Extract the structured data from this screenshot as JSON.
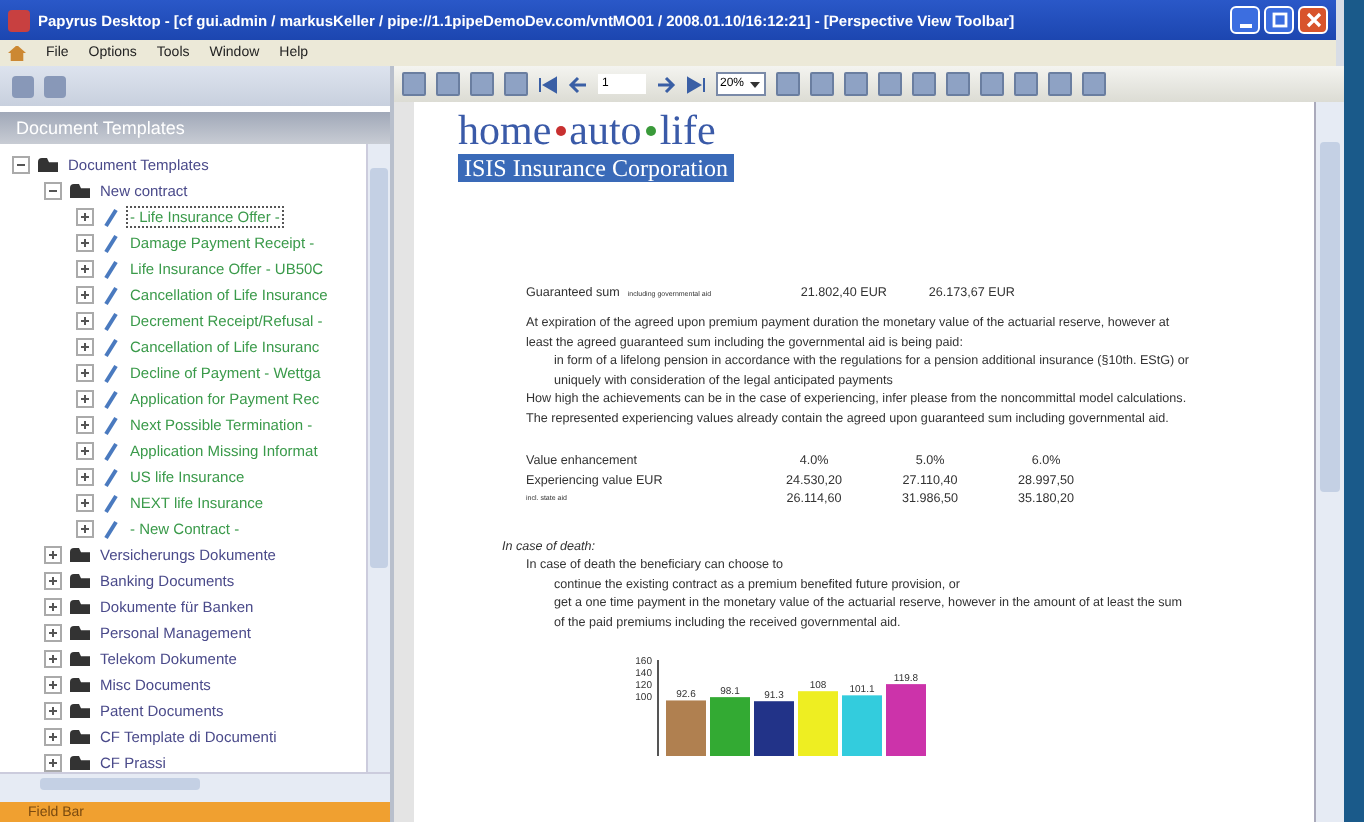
{
  "window": {
    "title": "Papyrus Desktop - [cf gui.admin / markusKeller / pipe://1.1pipeDemoDev.com/vntMO01 / 2008.01.10/16:12:21] - [Perspective View Toolbar]"
  },
  "menu": [
    "File",
    "Options",
    "Tools",
    "Window",
    "Help"
  ],
  "toolbar": {
    "page": "1",
    "zoom": "20%"
  },
  "sidebar": {
    "title": "Document Templates",
    "footer": "Field Bar",
    "tree": [
      {
        "label": "Document Templates",
        "kind": "folder",
        "expanded": true,
        "selected": false,
        "children": [
          {
            "label": "New contract",
            "kind": "folder",
            "expanded": true,
            "selected": false,
            "children": [
              {
                "label": "- Life Insurance Offer -",
                "kind": "template",
                "expanded": false,
                "selected": true
              },
              {
                "label": "Damage Payment Receipt -",
                "kind": "template",
                "expanded": false,
                "selected": false
              },
              {
                "label": "Life Insurance Offer - UB50C",
                "kind": "template",
                "expanded": false,
                "selected": false
              },
              {
                "label": "Cancellation of Life Insurance",
                "kind": "template",
                "expanded": false,
                "selected": false
              },
              {
                "label": "Decrement Receipt/Refusal - ",
                "kind": "template",
                "expanded": false,
                "selected": false
              },
              {
                "label": "Cancellation of Life Insuranc",
                "kind": "template",
                "expanded": false,
                "selected": false
              },
              {
                "label": "Decline of Payment - Wettga",
                "kind": "template",
                "expanded": false,
                "selected": false
              },
              {
                "label": "Application for Payment Rec",
                "kind": "template",
                "expanded": false,
                "selected": false
              },
              {
                "label": "Next Possible Termination - ",
                "kind": "template",
                "expanded": false,
                "selected": false
              },
              {
                "label": "Application Missing Informat",
                "kind": "template",
                "expanded": false,
                "selected": false
              },
              {
                "label": "US life Insurance",
                "kind": "template",
                "expanded": false,
                "selected": false
              },
              {
                "label": "NEXT life Insurance",
                "kind": "template",
                "expanded": false,
                "selected": false
              },
              {
                "label": "- New Contract -",
                "kind": "template",
                "expanded": false,
                "selected": false
              }
            ]
          },
          {
            "label": "Versicherungs Dokumente",
            "kind": "folder",
            "expanded": false,
            "selected": false
          },
          {
            "label": "Banking Documents",
            "kind": "folder",
            "expanded": false,
            "selected": false
          },
          {
            "label": "Dokumente für Banken",
            "kind": "folder",
            "expanded": false,
            "selected": false
          },
          {
            "label": "Personal Management",
            "kind": "folder",
            "expanded": false,
            "selected": false
          },
          {
            "label": "Telekom Dokumente",
            "kind": "folder",
            "expanded": false,
            "selected": false
          },
          {
            "label": "Misc Documents",
            "kind": "folder",
            "expanded": false,
            "selected": false
          },
          {
            "label": "Patent Documents",
            "kind": "folder",
            "expanded": false,
            "selected": false
          },
          {
            "label": "CF Template di Documenti",
            "kind": "folder",
            "expanded": false,
            "selected": false
          },
          {
            "label": "CF Prassi",
            "kind": "folder",
            "expanded": false,
            "selected": false
          }
        ]
      }
    ]
  },
  "document": {
    "logo_top": [
      "home",
      "auto",
      "life"
    ],
    "logo_bottom": "ISIS Insurance Corporation",
    "guaranteed": {
      "label": "Guaranteed sum",
      "note": "including governmental aid",
      "values": [
        "21.802,40 EUR",
        "26.173,67 EUR"
      ]
    },
    "paragraph": "At expiration of the agreed upon premium payment duration the monetary value of the actuarial reserve, however at least the agreed guaranteed sum including the governmental aid is being paid:",
    "bullets": [
      "in form of a lifelong pension in accordance with the regulations for a pension additional insurance (§10th. EStG) or",
      "uniquely with consideration of the legal anticipated payments"
    ],
    "paragraph2": "How high the achievements can be in the case of experiencing, infer please from the noncommittal model calculations. The represented experiencing values already contain the agreed upon guaranteed sum including governmental aid.",
    "values_table": [
      [
        "Value enhancement",
        "4.0%",
        "5.0%",
        "6.0%"
      ],
      [
        "Experiencing value EUR",
        "24.530,20",
        "27.110,40",
        "28.997,50"
      ],
      [
        "incl. state aid",
        "26.114,60",
        "31.986,50",
        "35.180,20"
      ]
    ],
    "death_heading": "In case of death:",
    "death_intro": "In case of death the beneficiary can choose to",
    "death_bullets": [
      "continue the existing contract as a premium benefited future provision, or",
      "get a one time payment in the monetary value of the actuarial reserve, however in the amount of at least the sum of the paid premiums including the received governmental aid."
    ],
    "chart_data": {
      "type": "bar",
      "values": [
        92.6,
        98.1,
        91.3,
        108,
        101.1,
        119.8
      ],
      "colors": [
        "#b08050",
        "#33aa33",
        "#223388",
        "#eeee22",
        "#33ccdd",
        "#cc33aa"
      ],
      "yticks": [
        {
          "value": 100,
          "label": "100"
        },
        {
          "value": 120,
          "label": "120"
        },
        {
          "value": 140,
          "label": "140"
        },
        {
          "value": 160,
          "label": "160"
        }
      ],
      "ylim": [
        0,
        160
      ],
      "value_labels": [
        "92.6",
        "98.1",
        "91.3",
        "108",
        "101.1",
        "119.8"
      ]
    }
  }
}
